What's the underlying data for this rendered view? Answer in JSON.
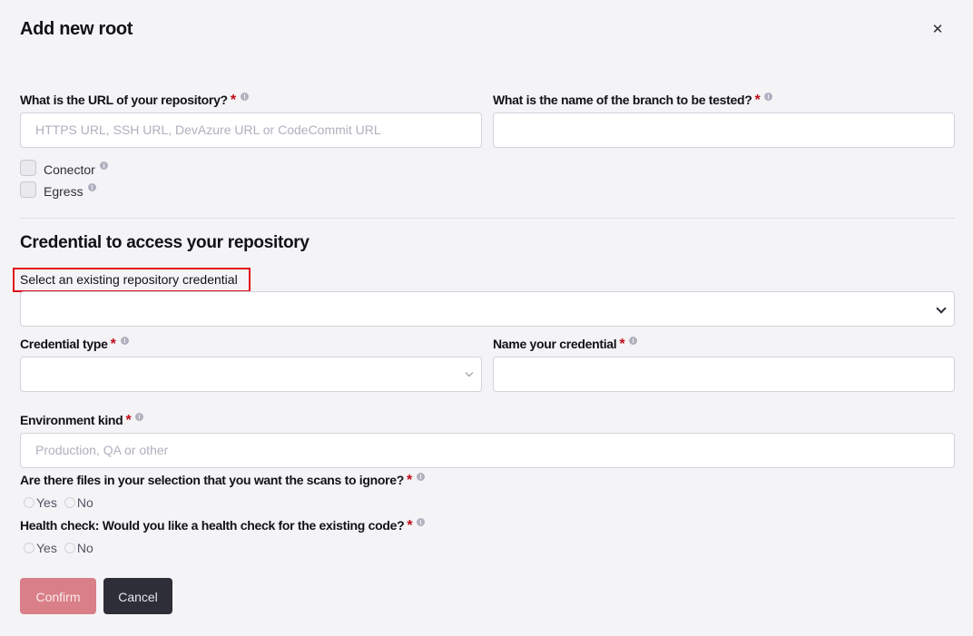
{
  "modal": {
    "title": "Add new root",
    "close_icon": "close-icon"
  },
  "fields": {
    "url": {
      "label": "What is the URL of your repository?",
      "required_mark": "*",
      "placeholder": "HTTPS URL, SSH URL, DevAzure URL or CodeCommit URL",
      "value": ""
    },
    "branch": {
      "label": "What is the name of the branch to be tested?",
      "required_mark": "*",
      "value": ""
    },
    "checkboxes": [
      {
        "label": "Conector",
        "checked": false
      },
      {
        "label": "Egress",
        "checked": false
      }
    ]
  },
  "credential_section": {
    "title": "Credential to access your repository",
    "existing_label": "Select an existing repository credential",
    "existing_value": "",
    "credential_type": {
      "label": "Credential type",
      "required_mark": "*",
      "value": ""
    },
    "credential_name": {
      "label": "Name your credential",
      "required_mark": "*",
      "value": ""
    },
    "environment": {
      "label": "Environment kind",
      "required_mark": "*",
      "placeholder": "Production, QA or other",
      "value": ""
    },
    "ignore_files": {
      "label": "Are there files in your selection that you want the scans to ignore?",
      "required_mark": "*",
      "options": [
        "Yes",
        "No"
      ],
      "selected": null
    },
    "health_check": {
      "label": "Health check: Would you like a health check for the existing code?",
      "required_mark": "*",
      "options": [
        "Yes",
        "No"
      ],
      "selected": null
    }
  },
  "actions": {
    "confirm_label": "Confirm",
    "cancel_label": "Cancel"
  },
  "colors": {
    "required": "#bf0b1a",
    "highlight": "#e0101e",
    "confirm_bg": "#d97f87",
    "cancel_bg": "#2e2e38"
  }
}
